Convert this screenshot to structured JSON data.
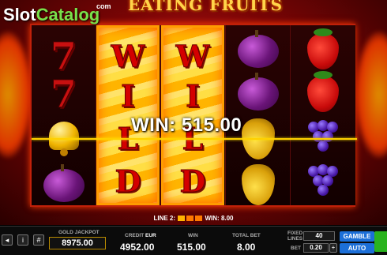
{
  "game_title": "EATING FRUITS",
  "logo": {
    "part1": "Slot",
    "part2": "Catalog",
    "suffix": "com"
  },
  "wild_letters": [
    "W",
    "I",
    "L",
    "D"
  ],
  "win_banner": "WIN: 515.00",
  "line_info": {
    "line": "LINE 2:",
    "win": "WIN: 8.00"
  },
  "footer": {
    "jackpot_label": "GOLD JACKPOT",
    "jackpot_value": "8975.00",
    "credit_label": "CREDIT",
    "currency": "EUR",
    "credit_value": "4952.00",
    "win_label": "WIN",
    "win_value": "515.00",
    "total_bet_label": "TOTAL BET",
    "total_bet_value": "8.00",
    "fixed_lines_label": "FIXED\nLINES",
    "fixed_lines_value": "40",
    "bet_label": "BET",
    "bet_value": "0.20",
    "gamble_label": "GAMBLE",
    "auto_label": "AUTO"
  },
  "icons": [
    "sound-icon",
    "info-icon",
    "paytable-icon",
    "plus-icon"
  ],
  "colors": {
    "reel_frame": "#c0200a",
    "wild_red": "#d40000",
    "win_line": "#ffd000",
    "button_blue": "#1c6fd8",
    "spin_green": "#29b31e"
  }
}
